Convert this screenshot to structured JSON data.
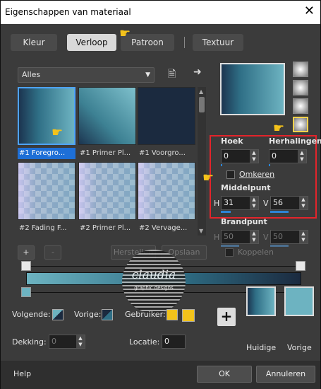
{
  "window": {
    "title": "Eigenschappen van materiaal",
    "close_glyph": "✕"
  },
  "tabs": [
    {
      "label": "Kleur",
      "active": false
    },
    {
      "label": "Verloop",
      "active": true
    },
    {
      "label": "Patroon",
      "active": false
    },
    {
      "label": "Textuur",
      "active": false
    }
  ],
  "category_dropdown": {
    "value": "Alles"
  },
  "presets": [
    {
      "caption": "#1 Foregro...",
      "selected": true,
      "style": "g1"
    },
    {
      "caption": "#1 Primer Pl...",
      "selected": false,
      "style": "g2"
    },
    {
      "caption": "#1 Voorgro...",
      "selected": false,
      "style": "g3"
    },
    {
      "caption": "#2 Fading F...",
      "selected": false,
      "style": "chk"
    },
    {
      "caption": "#2 Primer Pl...",
      "selected": false,
      "style": "chk"
    },
    {
      "caption": "#2 Vervage...",
      "selected": false,
      "style": "chk"
    }
  ],
  "style_buttons": [
    "linear-icon",
    "radial-icon",
    "rectangular-icon",
    "sunburst-icon"
  ],
  "settings": {
    "hoek_label": "Hoek",
    "hoek_value": "0",
    "herhalingen_label": "Herhalingen",
    "herhalingen_value": "0",
    "omkeren_label": "Omkeren",
    "omkeren_checked": false,
    "middelpunt_label": "Middelpunt",
    "h_label": "H",
    "h_value": "31",
    "v_label": "V",
    "v_value": "56",
    "brandpunt_label": "Brandpunt",
    "bh_value": "50",
    "bv_value": "50",
    "koppelen_label": "Koppelen"
  },
  "editor_buttons": {
    "add": "+",
    "remove": "-",
    "reset": "Herstellen",
    "save": "Opslaan"
  },
  "watermark": {
    "line1": "claudia",
    "line2": "graphic designs"
  },
  "bottom": {
    "volgende_label": "Volgende:",
    "vorige_label": "Vorige:",
    "gebruiker_label": "Gebruiker:",
    "dekking_label": "Dekking:",
    "dekking_value": "0",
    "locatie_label": "Locatie:",
    "locatie_value": "0",
    "huidige_label": "Huidige",
    "vorige_label2": "Vorige",
    "plus_glyph": "+"
  },
  "footer": {
    "help": "Help",
    "ok": "OK",
    "cancel": "Annuleren"
  },
  "colors": {
    "accent": "#2c85d6",
    "highlight": "#e3242b",
    "gradient_light": "#6db3c1",
    "gradient_dark": "#1b2a3f",
    "user_swatch": "#f2c31b"
  }
}
